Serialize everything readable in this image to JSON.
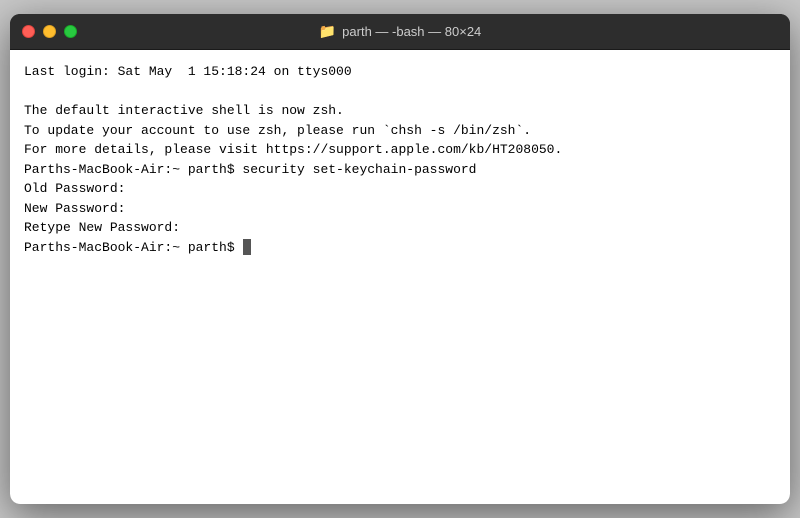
{
  "window": {
    "title": "parth — -bash — 80×24",
    "traffic_lights": {
      "close_label": "close",
      "minimize_label": "minimize",
      "maximize_label": "maximize"
    }
  },
  "terminal": {
    "lines": [
      "Last login: Sat May  1 15:18:24 on ttys000",
      "",
      "The default interactive shell is now zsh.",
      "To update your account to use zsh, please run `chsh -s /bin/zsh`.",
      "For more details, please visit https://support.apple.com/kb/HT208050.",
      "Parths-MacBook-Air:~ parth$ security set-keychain-password",
      "Old Password:",
      "New Password:",
      "Retype New Password:",
      "Parths-MacBook-Air:~ parth$ "
    ]
  }
}
